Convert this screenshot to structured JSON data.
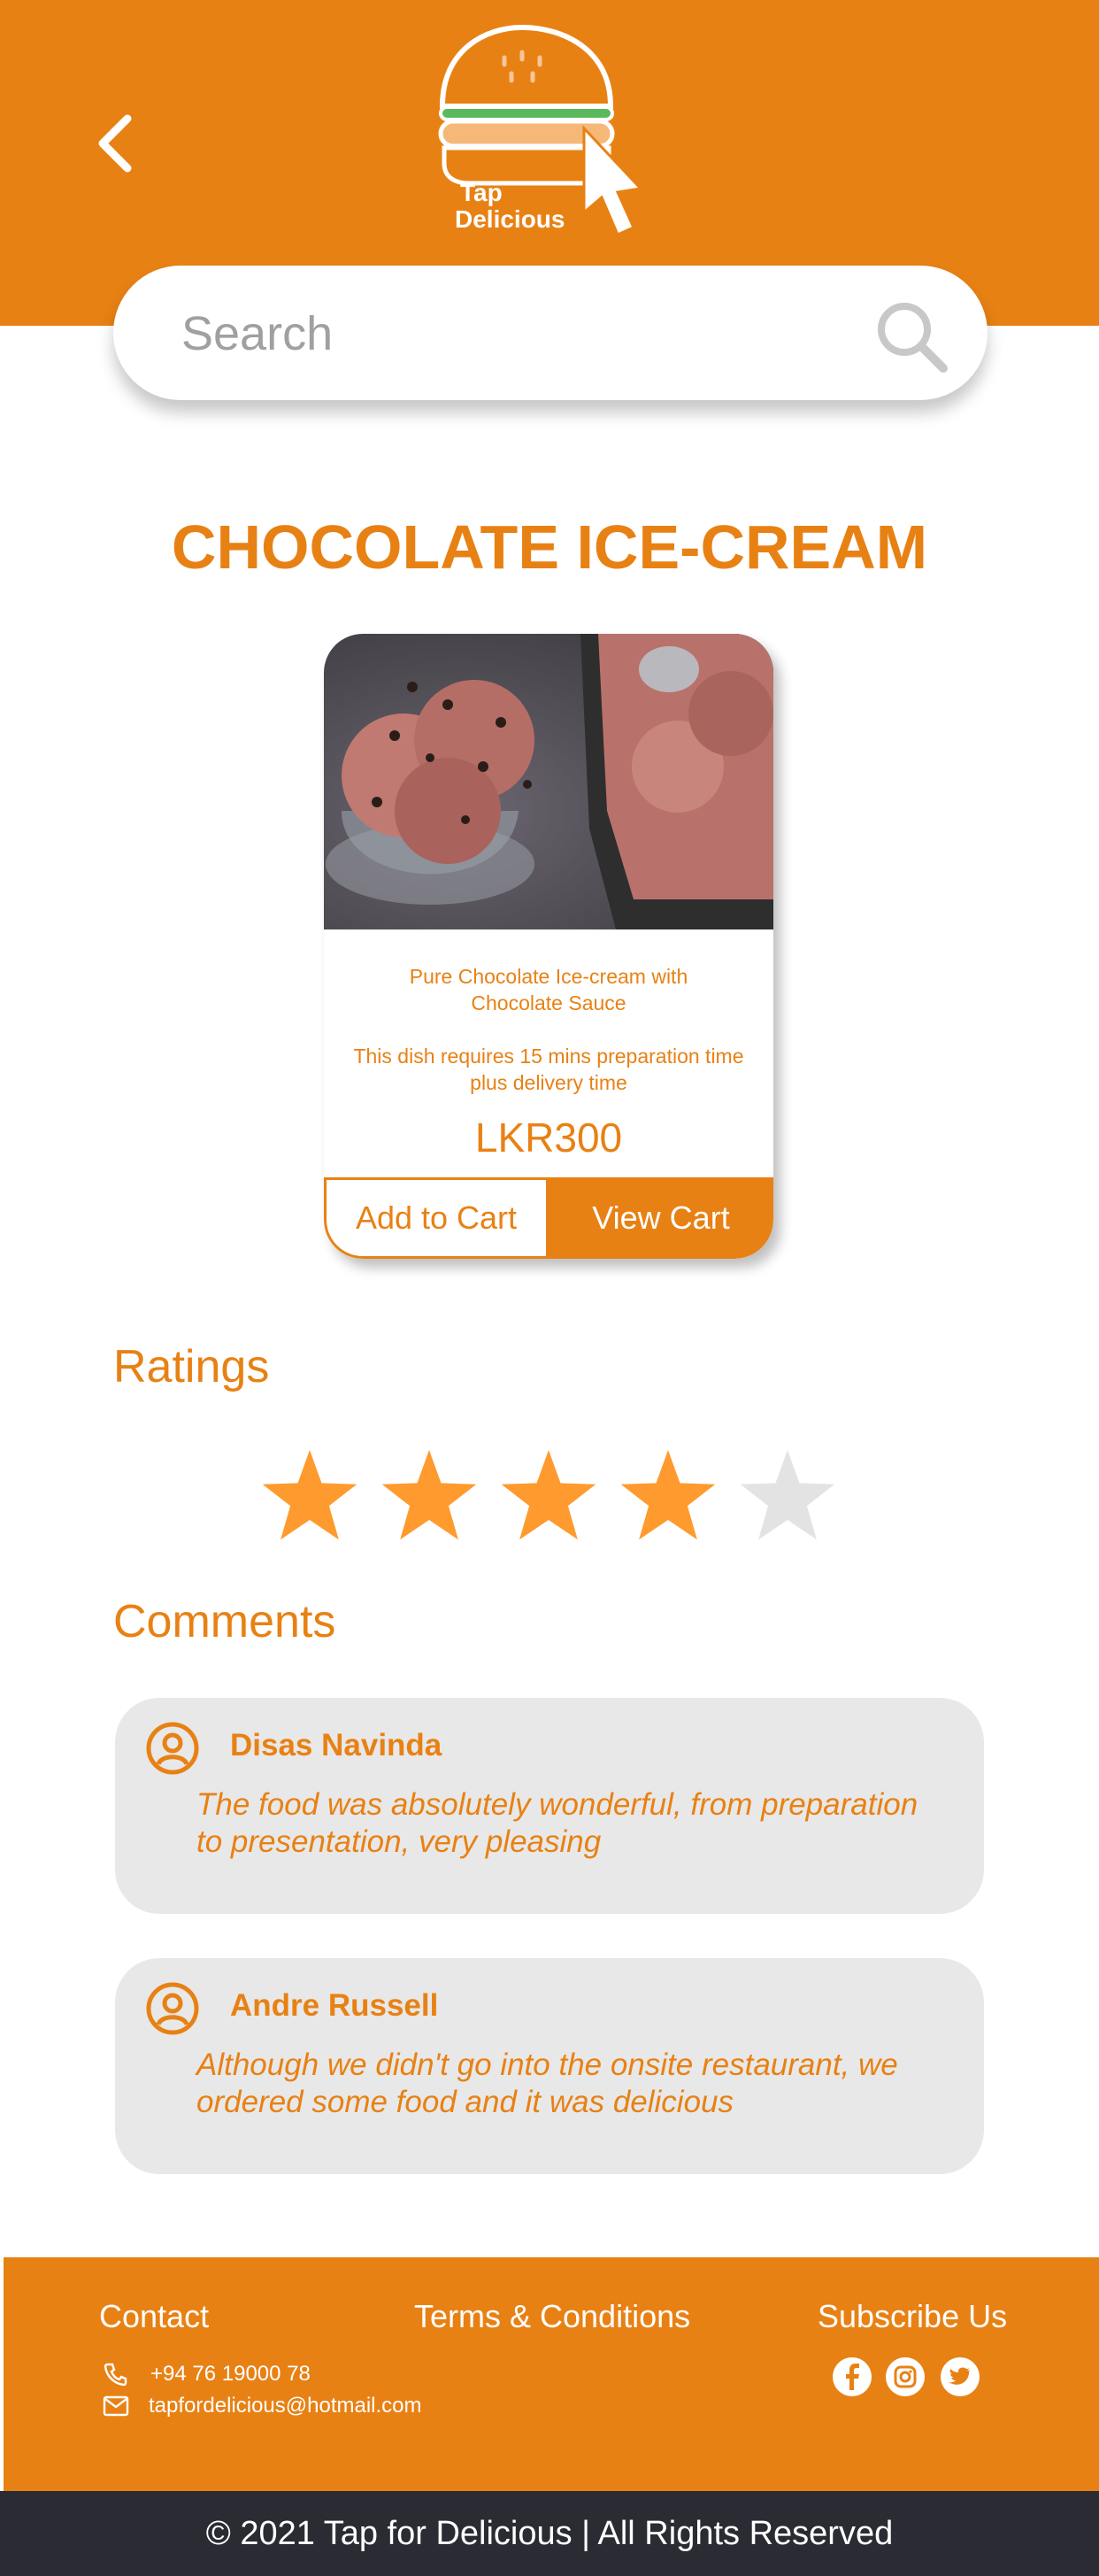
{
  "brand": {
    "logo_line1": "Tap",
    "logo_line2": "Delicious"
  },
  "search": {
    "placeholder": "Search"
  },
  "product": {
    "title": "CHOCOLATE ICE-CREAM",
    "description_line1": "Pure Chocolate Ice-cream  with",
    "description_line2": "Chocolate Sauce",
    "prep_line1": "This dish requires 15 mins preparation time",
    "prep_line2": "plus delivery time",
    "price": "LKR300",
    "add_to_cart_label": "Add to Cart",
    "view_cart_label": "View Cart"
  },
  "ratings": {
    "heading": "Ratings",
    "value": 4,
    "max": 5,
    "filled_color": "#ff9a2e",
    "empty_color": "#e3e3e3"
  },
  "comments": {
    "heading": "Comments",
    "items": [
      {
        "name": "Disas Navinda",
        "line1": "The food was absolutely wonderful, from preparation",
        "line2": "to presentation, very pleasing"
      },
      {
        "name": "Andre Russell",
        "line1": "Although we didn't go into the onsite restaurant, we",
        "line2": "ordered some food and it was delicious"
      }
    ]
  },
  "footer": {
    "contact_heading": "Contact",
    "phone": "+94 76 19000 78",
    "email": "tapfordelicious@hotmail.com",
    "terms_label": "Terms & Conditions",
    "subscribe_heading": "Subscribe Us",
    "social_icons": [
      "facebook-icon",
      "instagram-icon",
      "twitter-icon"
    ],
    "copyright": "© 2021 Tap for Delicious | All Rights Reserved"
  },
  "colors": {
    "accent": "#e88114",
    "footer_dark": "#2a2b33",
    "comment_bg": "#e8e8e8"
  }
}
